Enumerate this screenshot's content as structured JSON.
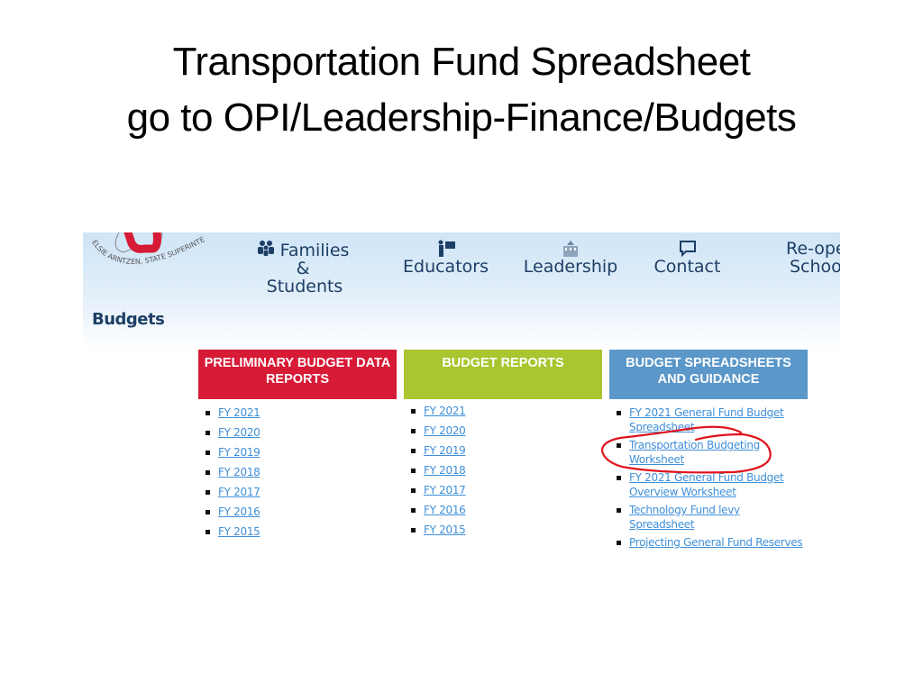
{
  "slide": {
    "title_line1": "Transportation Fund Spreadsheet",
    "title_line2": "go to OPI/Leadership-Finance/Budgets"
  },
  "site": {
    "logo_caption": "ELSIE ARNTZEN, STATE SUPERINTENDENT",
    "nav": [
      {
        "label_line1": "Families &",
        "label_line2": "Students",
        "icon": "families-icon"
      },
      {
        "label_line1": "",
        "label_line2": "Educators",
        "icon": "educator-icon"
      },
      {
        "label_line1": "",
        "label_line2": "Leadership",
        "icon": "building-icon"
      },
      {
        "label_line1": "",
        "label_line2": "Contact",
        "icon": "chat-icon"
      },
      {
        "label_line1": "Re-ope",
        "label_line2": "Schoo",
        "icon": ""
      }
    ],
    "page_heading": "Budgets",
    "colors": {
      "red": "#d71a36",
      "green": "#a9c52f",
      "blue": "#5b97c9",
      "nav_text": "#1d3f66",
      "link": "#3f8fd8",
      "annotation": "#e0141e"
    },
    "columns": [
      {
        "header": "PRELIMINARY BUDGET DATA REPORTS",
        "links": [
          "FY 2021",
          "FY 2020",
          "FY 2019",
          "FY 2018",
          "FY 2017",
          "FY 2016",
          "FY 2015"
        ]
      },
      {
        "header": "BUDGET REPORTS",
        "links": [
          "FY 2021",
          "FY 2020",
          "FY 2019",
          "FY 2018",
          "FY 2017",
          "FY 2016",
          "FY 2015"
        ]
      },
      {
        "header": "BUDGET SPREADSHEETS AND GUIDANCE",
        "links": [
          "FY 2021 General Fund Budget Spreadsheet",
          "Transportation Budgeting Worksheet",
          "FY 2021 General Fund Budget Overview Worksheet",
          "Technology Fund levy Spreadsheet",
          "Projecting General Fund Reserves"
        ]
      }
    ],
    "highlighted_link": "Transportation Budgeting Worksheet"
  }
}
